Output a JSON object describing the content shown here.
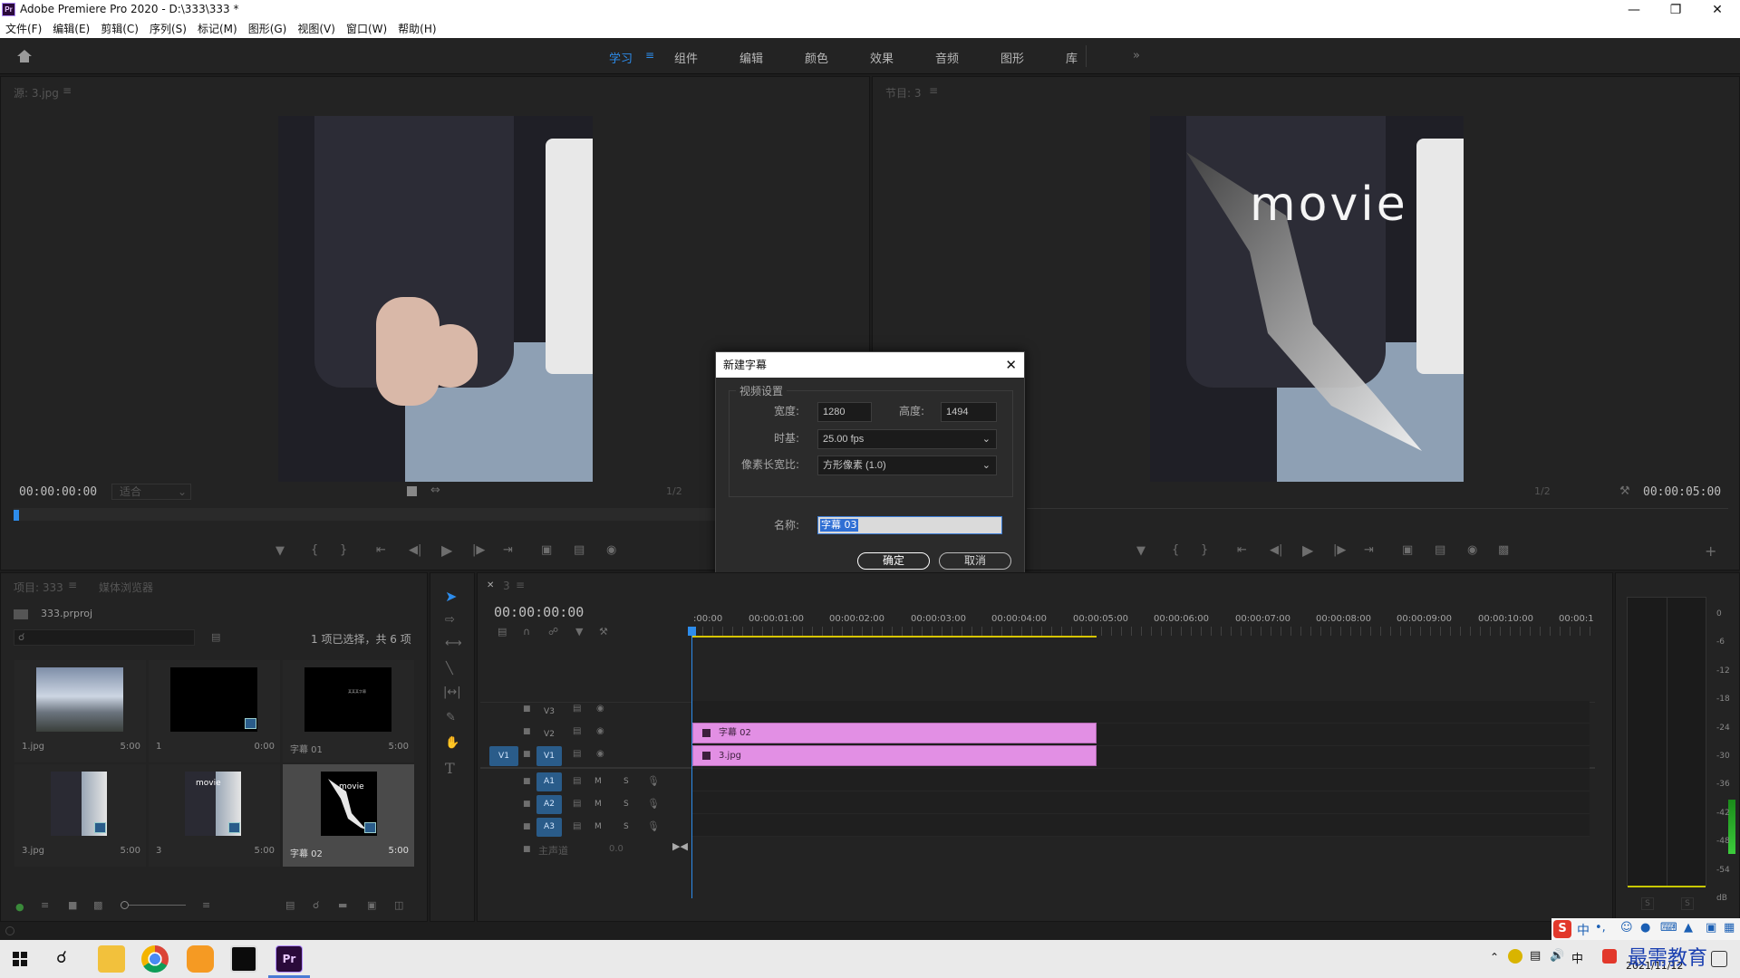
{
  "window": {
    "title": "Adobe Premiere Pro 2020 - D:\\333\\333 *",
    "app_icon": "Pr"
  },
  "menu": [
    "文件(F)",
    "编辑(E)",
    "剪辑(C)",
    "序列(S)",
    "标记(M)",
    "图形(G)",
    "视图(V)",
    "窗口(W)",
    "帮助(H)"
  ],
  "workspaces": {
    "tabs": [
      "学习",
      "组件",
      "编辑",
      "颜色",
      "效果",
      "音频",
      "图形",
      "库"
    ],
    "active": "学习",
    "more": "»"
  },
  "source_monitor": {
    "title": "源: 3.jpg",
    "timecode": "00:00:00:00",
    "fit": "适合",
    "resolution": "1/2"
  },
  "program_monitor": {
    "title": "节目: 3",
    "overlay_text": "movie",
    "timecode": "00:00:05:00",
    "resolution": "1/2"
  },
  "dialog": {
    "title": "新建字幕",
    "group": "视频设置",
    "width_label": "宽度:",
    "width_value": "1280",
    "height_label": "高度:",
    "height_value": "1494",
    "timebase_label": "时基:",
    "timebase_value": "25.00 fps",
    "pixel_aspect_label": "像素长宽比:",
    "pixel_aspect_value": "方形像素 (1.0)",
    "name_label": "名称:",
    "name_value": "字幕 03",
    "ok": "确定",
    "cancel": "取消"
  },
  "project": {
    "tab_project": "项目: 333",
    "tab_media": "媒体浏览器",
    "file": "333.prproj",
    "selection_info": "1 项已选择，共 6 项",
    "items": [
      {
        "name": "1.jpg",
        "duration": "5:00"
      },
      {
        "name": "1",
        "duration": "0:00"
      },
      {
        "name": "字幕 01",
        "duration": "5:00"
      },
      {
        "name": "3.jpg",
        "duration": "5:00"
      },
      {
        "name": "3",
        "duration": "5:00"
      },
      {
        "name": "字幕 02",
        "duration": "5:00"
      }
    ],
    "thumb_text_small": "某某某字幕",
    "thumb_text_movie": "movie"
  },
  "timeline": {
    "tab": "3",
    "timecode": "00:00:00:00",
    "ruler": [
      ":00:00",
      "00:00:01:00",
      "00:00:02:00",
      "00:00:03:00",
      "00:00:04:00",
      "00:00:05:00",
      "00:00:06:00",
      "00:00:07:00",
      "00:00:08:00",
      "00:00:09:00",
      "00:00:10:00",
      "00:00:1"
    ],
    "tracks": {
      "v3": "V3",
      "v2": "V2",
      "v1": "V1",
      "v1_src": "V1",
      "a1": "A1",
      "a2": "A2",
      "a3": "A3",
      "master": "主声道",
      "master_value": "0.0",
      "m": "M",
      "s": "S"
    },
    "clips": {
      "v2": "字幕 02",
      "v1": "3.jpg"
    }
  },
  "meter": {
    "scale": [
      "0",
      "-6",
      "-12",
      "-18",
      "-24",
      "-30",
      "-36",
      "-42",
      "-48",
      "-54",
      "dB"
    ],
    "solo": "S"
  },
  "taskbar": {
    "date": "2021/11/12",
    "ime": "中",
    "watermark": "最需教育"
  }
}
